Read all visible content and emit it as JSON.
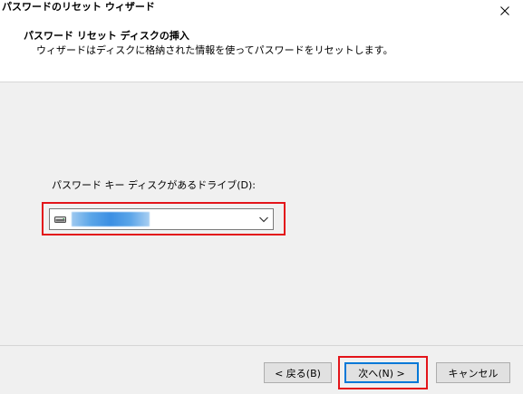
{
  "window": {
    "title": "パスワードのリセット ウィザード"
  },
  "header": {
    "title": "パスワード リセット ディスクの挿入",
    "description": "ウィザードはディスクに格納された情報を使ってパスワードをリセットします。"
  },
  "drive": {
    "label": "パスワード キー ディスクがあるドライブ(D):",
    "selected_value": ""
  },
  "buttons": {
    "back": "< 戻る(B)",
    "next": "次へ(N) >",
    "cancel": "キャンセル"
  },
  "colors": {
    "highlight": "#e3141a",
    "accent": "#0078d7"
  },
  "icons": {
    "close": "close-icon",
    "drive": "drive-icon",
    "dropdown": "chevron-down-icon"
  }
}
